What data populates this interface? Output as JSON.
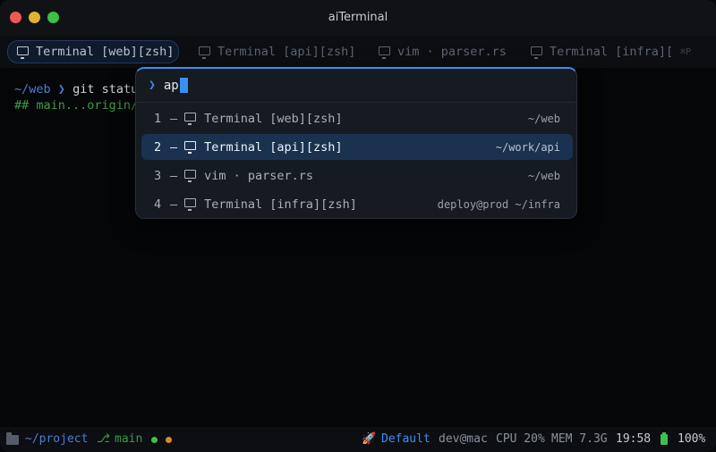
{
  "window": {
    "title": "aiTerminal"
  },
  "tabs": [
    {
      "label": "Terminal [web][zsh]",
      "active": true
    },
    {
      "label": "Terminal [api][zsh]",
      "active": false
    },
    {
      "label": "vim · parser.rs",
      "active": false
    },
    {
      "label": "Terminal [infra][",
      "active": false
    }
  ],
  "tab_hint": "⌘P",
  "terminal": {
    "line1": {
      "path": "~/web",
      "prompt": "❯",
      "command": "git statu"
    },
    "line2": {
      "text": "## main...origin/"
    }
  },
  "palette": {
    "query": "ap",
    "prompt_icon": "❯",
    "results": [
      {
        "index": "1",
        "sep": "—",
        "icon": "monitor-icon",
        "title": "Terminal [web][zsh]",
        "path": "~/web",
        "selected": false
      },
      {
        "index": "2",
        "sep": "—",
        "icon": "monitor-icon",
        "title": "Terminal [api][zsh]",
        "path": "~/work/api",
        "selected": true
      },
      {
        "index": "3",
        "sep": "—",
        "icon": "monitor-icon",
        "title": "vim · parser.rs",
        "path": "~/web",
        "selected": false
      },
      {
        "index": "4",
        "sep": "—",
        "icon": "monitor-icon",
        "title": "Terminal [infra][zsh]",
        "path": "deploy@prod ~/infra",
        "selected": false
      }
    ]
  },
  "statusbar": {
    "project": "~/project",
    "branch_icon": "⎇",
    "branch": "main",
    "rocket_icon": "🚀",
    "profile": "Default",
    "user": "dev@mac",
    "cpu": "CPU 20%",
    "mem": "MEM 7.3G",
    "time": "19:58",
    "battery": "100%"
  },
  "colors": {
    "accent": "#3b8ff0",
    "path_blue": "#4f7bd6",
    "git_green": "#3e9a47",
    "selected_row": "#1b3150"
  }
}
